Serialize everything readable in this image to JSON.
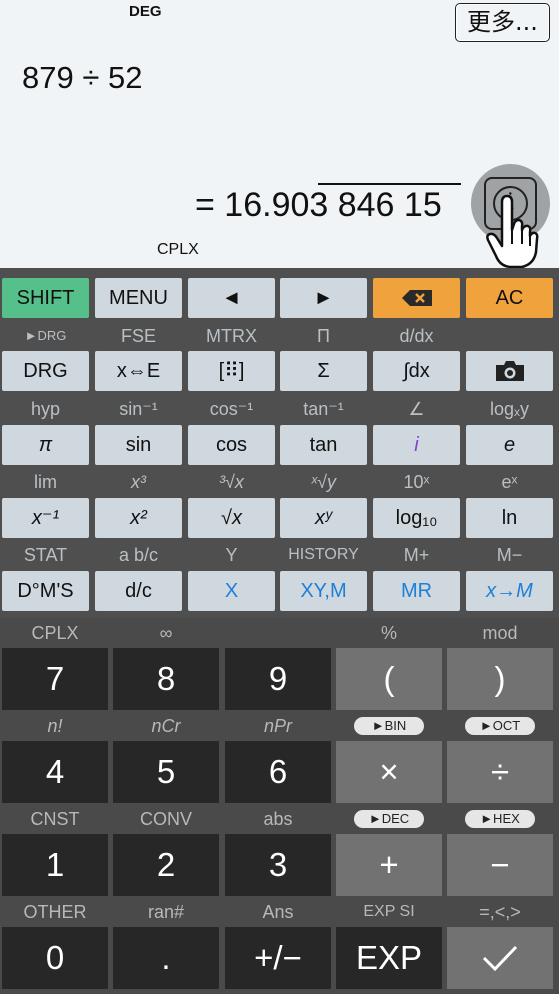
{
  "display": {
    "angle_mode": "DEG",
    "more_label": "更多...",
    "expression": "879 ÷ 52",
    "result_eq": "= 16.903 846 15",
    "complex_mode": "CPLX"
  },
  "row0": [
    "SHIFT",
    "MENU",
    "◄",
    "►",
    "⌫",
    "AC"
  ],
  "row1_labels": [
    "►DRG",
    "FSE",
    "MTRX",
    "Π",
    "d/dx",
    ""
  ],
  "row1": [
    "DRG",
    "x⇔E",
    "[⠿]",
    "Σ",
    "∫dx",
    ""
  ],
  "row2_labels": [
    "hyp",
    "sin⁻¹",
    "cos⁻¹",
    "tan⁻¹",
    "∠",
    "logₓy"
  ],
  "row2": [
    "π",
    "sin",
    "cos",
    "tan",
    "i",
    "e"
  ],
  "row3_labels": [
    "lim",
    "x³",
    "³√x",
    "ˣ√y",
    "10ˣ",
    "eˣ"
  ],
  "row3": [
    "x⁻¹",
    "x²",
    "√x",
    "xʸ",
    "log₁₀",
    "ln"
  ],
  "row4_labels": [
    "STAT",
    "a b/c",
    "Y",
    "HISTORY",
    "M+",
    "M−"
  ],
  "row4": [
    "D°M'S",
    "d/c",
    "X",
    "XY,M",
    "MR",
    "x→M"
  ],
  "num_labels_1": [
    "CPLX",
    "∞",
    "",
    "%",
    "mod"
  ],
  "num_row_1": [
    "7",
    "8",
    "9",
    "(",
    ")"
  ],
  "num_labels_2": [
    "n!",
    "nCr",
    "nPr"
  ],
  "pills_2": [
    "►BIN",
    "►OCT"
  ],
  "num_row_2": [
    "4",
    "5",
    "6",
    "×",
    "÷"
  ],
  "num_labels_3": [
    "CNST",
    "CONV",
    "abs"
  ],
  "pills_3": [
    "►DEC",
    "►HEX"
  ],
  "num_row_3": [
    "1",
    "2",
    "3",
    "+",
    "−"
  ],
  "num_labels_4": [
    "OTHER",
    "ran#",
    "Ans",
    "EXP SI",
    "=,<,>"
  ],
  "num_row_4": [
    "0",
    ".",
    "+/−",
    "EXP",
    "✓"
  ],
  "colors": {
    "shift": "#56c08a",
    "orange": "#f0a23c",
    "blue_text": "#1d7fd8",
    "key_light": "#cfd8de"
  }
}
